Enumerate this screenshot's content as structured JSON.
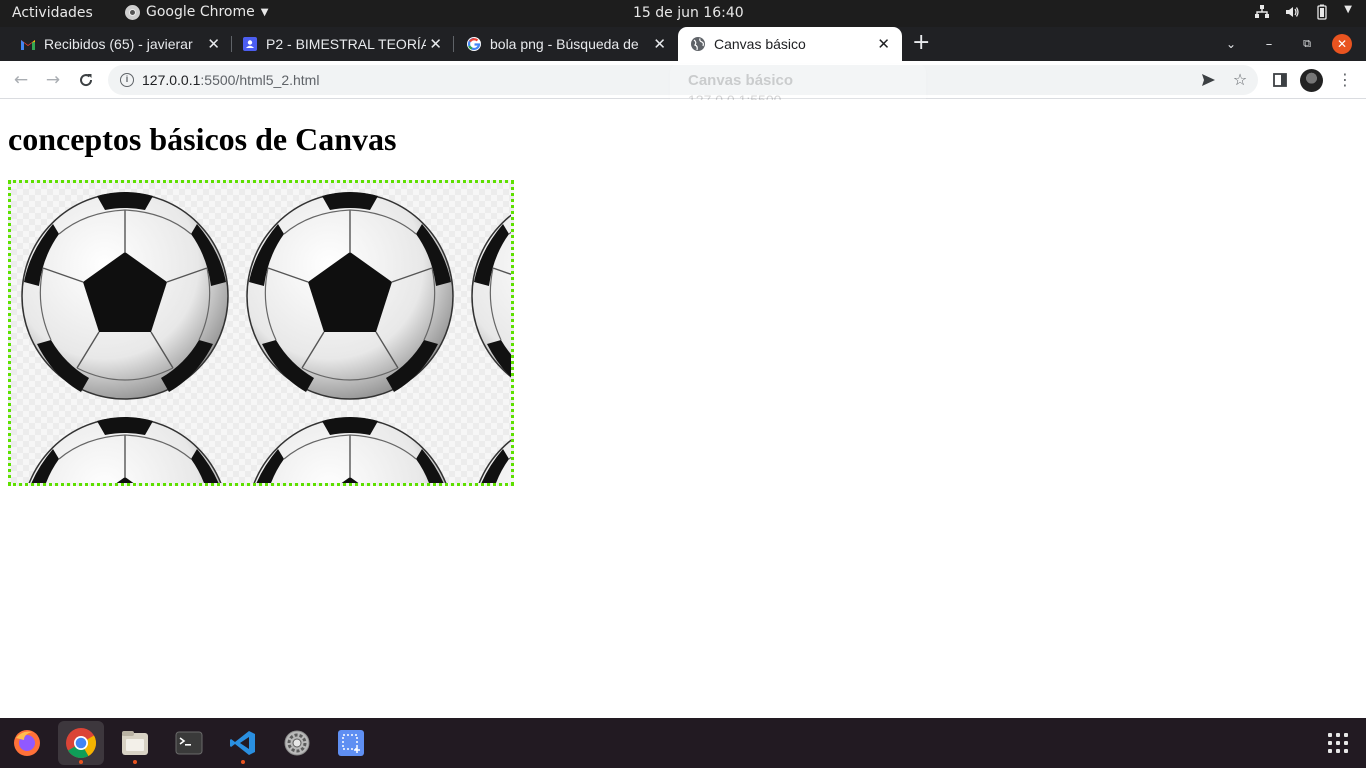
{
  "topbar": {
    "activities": "Actividades",
    "app_name": "Google Chrome",
    "clock": "15 de jun  16:40",
    "icons": [
      "network-icon",
      "volume-icon",
      "battery-icon",
      "power-menu-icon"
    ]
  },
  "tabs": [
    {
      "title": "Recibidos (65) - javierar",
      "icon": "gmail-icon",
      "active": false
    },
    {
      "title": "P2 - BIMESTRAL TEORÍA",
      "icon": "classroom-icon",
      "active": false
    },
    {
      "title": "bola png - Búsqueda de",
      "icon": "google-icon",
      "active": false
    },
    {
      "title": "Canvas básico",
      "icon": "globe-icon",
      "active": true
    }
  ],
  "toolbar": {
    "url_host": "127.0.0.1",
    "url_rest": ":5500/html5_2.html"
  },
  "hover_card": {
    "title": "Canvas básico",
    "url": "127.0.0.1:5500"
  },
  "page": {
    "heading": "conceptos básicos de Canvas",
    "canvas_border_color": "#5ee000"
  },
  "dock": {
    "apps": [
      "firefox-icon",
      "chrome-icon",
      "files-icon",
      "terminal-icon",
      "vscode-icon",
      "settings-icon",
      "screenshot-icon"
    ],
    "active": "chrome-icon"
  },
  "colors": {
    "accent": "#e95420",
    "tab_strip": "#202124"
  }
}
